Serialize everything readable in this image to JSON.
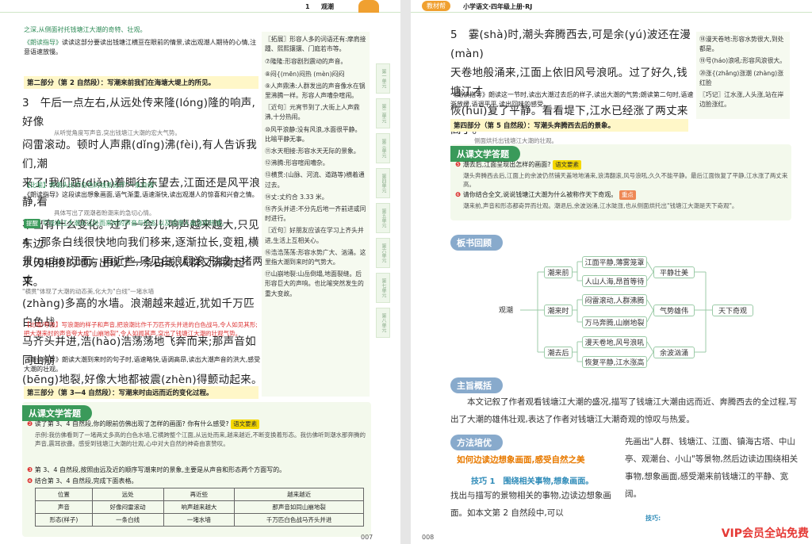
{
  "left": {
    "header": {
      "lesson_num": "1",
      "lesson_title": "观潮"
    },
    "top_text_1": "之深,从侧面衬托钱塘江大潮的奇特、壮观。",
    "top_guide_label": "《朗读指导》",
    "top_guide_text": "读读这部分要读出钱塘江横亘在眼前的情景,读出观潮人期待的心情,注意语速放慢。",
    "part2": "第二部分（第 2 自然段）：写潮来前我们在海塘大堤上的所见。",
    "para3_lines": [
      "3　午后一点左右,从远处传来隆(lóng)隆的响声,好像",
      "闷雷滚动。顿时人声鼎(dǐng)沸(fèi),有人告诉我们,潮",
      "来了!我们踮(diǎn)着脚往东望去,江面还是风平浪静,看",
      "不出有什么变化。过了一会儿,响声越来越大,只见东边",
      "水天相接的地方出现了一条白线,人群又沸腾起来。"
    ],
    "para3_note1": "从听觉角度写声音,突出钱塘江大潮的宏大气势。",
    "para3_note2": "具体写出了观潮者盼潮来的急切心情。",
    "para3_note3": "【比喻】将潮头比作白色的线条比作\"一条白线\"",
    "para3_guide": "《朗读指导》这段读出想象画面,语气渐重,语速渐快,读出观潮人的惊喜和兴奋之情。",
    "tidian": "提醒",
    "tidian_text": "写钱塘江大潮从远处而来时的声音与形态,以及观潮人高涨的热情。",
    "para4_lines": [
      "4　那条白线很快地向我们移来,逐渐拉长,变粗,横",
      "贯(guàn)江面。再近些,只见白浪翻滚,形成一堵两丈",
      "(zhàng)多高的水墙。浪潮越来越近,犹如千万匹白色战",
      "马齐头并进,浩(hào)浩荡荡地飞奔而来;那声音如同山崩",
      "(bēng)地裂,好像大地都被震(zhèn)得颤动起来。"
    ],
    "para4_note1": "\"横贯\"体现了大潮的动态美,化大为\"白线\"一堵水墙",
    "para4_note2": "【比喻/夸张】写浪潮的样子和声音,把浪潮比作千万匹齐头并进的白色战马,令人如见其形;把大潮来时的声音夸大成\"山崩地裂\",令人如闻其声,突出了钱塘江大潮的壮观气势。",
    "para4_guide": "《朗读指导》朗读大潮到来时的句子时,语速略快,语调高昂,读出大潮声音的洪大,感受大潮的壮观。",
    "part3": "第三部分（第 3—4 自然段）：写潮来时由远而近的变化过程。",
    "qa_title": "从课文学答题",
    "q2": "读了第 3、4 自然段,你的眼前仿佛出现了怎样的画面? 你有什么感受?",
    "q2_tag": "语文要素",
    "q2_ans": "示例:我仿佛看到了一堵两丈多高的白色水墙,它横跨整个江面,从远处而来,越来越近,不断变换着形态。我仿佛听到潮水那奔腾的声音,震耳欲聋。感受到钱塘江大潮的壮观,心中对大自然的神奇由衷赞叹。",
    "q3": "第 3、4 自然段,按照由远及近的顺序写潮来时的景象,主要是从声音和形态两个方面写的。",
    "q4": "结合第 3、4 自然段,完成下面表格。",
    "table_head": [
      "位置",
      "远处",
      "再近些",
      "越来越近"
    ],
    "table_rows": [
      [
        "声音",
        "好像闷雷滚动",
        "响声越来越大",
        "那声音如同山崩地裂"
      ],
      [
        "形态(样子)",
        "一条白线",
        "一堵水墙",
        "千万匹白色战马齐头并进"
      ]
    ],
    "side_intro": "〖拓展〗形容人多的词语还有:摩肩接踵、熙熙攘攘、门庭若市等。",
    "side_items": [
      "⑦隆隆:形容剧烈震动的声音。",
      "⑧闷{(mēn)闷热 (mèn)闷闷",
      "⑨人声鼎沸:人群发出的声音像水在锅里沸腾一样。形容人声嘈杂喧闹。",
      "〖近句〗元宵节到了,大街上人声鼎沸,十分热闹。",
      "⑩风平浪静:没有风浪,水面很平静。比喻平静无事。",
      "⑪水天相接:形容水天无际的景象。",
      "⑫沸腾:形容喧闹嘈杂。",
      "⑬横贯:(山脉、河流、道路等)横着通过去。",
      "⑭丈:丈约合 3.33 米。",
      "⑮齐头并进:不分先后地一齐前进或同时进行。",
      "〖近句〗好朋友应该在学习上齐头并进,生活上互相关心。",
      "⑯浩浩荡荡:形容水势广大、汹涌。这里指大潮到来时的气势大。",
      "⑰山崩地裂:山岳倒塌,地面裂缝。后形容巨大的声响。也比喻突然发生的重大变故。"
    ],
    "page_num": "007"
  },
  "right": {
    "header": {
      "brand": "教材帮",
      "subject": "小学语文·四年级上册·RJ"
    },
    "para5_lines": [
      "5　霎(shà)时,潮头奔腾西去,可是余(yú)波还在漫(màn)",
      "天卷地般涌来,江面上依旧风号浪吼。过了好久,钱塘江才",
      "恢(huī)复了平静。看看堤下,江水已经涨了两丈来高了。"
    ],
    "para5_note": "描写潮头奔腾西去时的景象。",
    "para5_note2": "侧面烘托出钱塘江大潮的壮观。",
    "para5_guide": "《朗读指导》朗读这一节时,读出大潮过去后的样子,读出大潮的气势;朗读第二句时,语速渐放缓,语调平平,读出回味的感受。",
    "part4": "第四部分（第 5 自然段）：写潮头奔腾西去后的景象。",
    "qa_title": "从课文学答题",
    "q5": "潮去后,江面呈现出怎样的画面?",
    "q5_tag": "语文要素",
    "q5_ans": "潮头奔腾西去后,江面上的余波仍然铺天盖地地涌来,浪涛翻滚,风号浪吼,久久不能平静。最后江面恢复了平静,江水涨了两丈来高。",
    "q6": "请你结合全文,说说钱塘江大潮为什么被称作天下奇观。",
    "q6_tag": "重点",
    "q6_ans": "潮来前,声音和形态都奇异而壮观。潮退后,余波汹涌,江水陡涨,也从侧面烘托出\"钱塘江大潮是天下奇观\"。",
    "board_title": "板书回顾",
    "board": {
      "root": "观潮",
      "before": "潮来前",
      "during": "潮来时",
      "after": "潮去后",
      "b1": "江面平静,薄雾笼罩",
      "b2": "人山人海,昂首等待",
      "d1": "闷雷滚动,人群沸腾",
      "d2": "万马奔腾,山崩地裂",
      "a1": "漫天卷地,风号浪吼",
      "a2": "恢复平静,江水涨高",
      "r1": "平静壮美",
      "r2": "气势雄伟",
      "r3": "余波汹涌",
      "final": "天下奇观"
    },
    "summary_title": "主旨概括",
    "summary_text": "本文记叙了作者观看钱塘江大潮的盛况,描写了钱塘江大潮由远而近、奔腾西去的全过程,写出了大潮的雄伟壮观,表达了作者对钱塘江大潮奇观的惊叹与热爱。",
    "method_title": "方法培优",
    "method_sub": "如何边读边想象画面,感受自然之美",
    "tip1": "技巧 1　围绕相关事物,想象画面。",
    "tip1_text": "找出与描写的景物相关的事物,边读边想象画面。如本文第 2 自然段中,可以",
    "right_col": "先画出\"人群、钱塘江、江面、镇海古塔、中山亭、观潮台、小山\"等景物,然后边读边围绕相关事物,想象画面,感受潮来前钱塘江的平静、宽阔。",
    "tip2_label": "技巧:",
    "side_items": [
      "⑱漫天卷地:形容水势很大,到处都是。",
      "⑲号(háo)浪吼:形容风浪很大。",
      "⑳涨{(zhǎng)涨潮 (zhàng)涨红脸",
      "〖巧记〗江水涨,人头涨,站在岸边脸涨红。"
    ],
    "page_num": "008",
    "vip": "VIP会员全站免费"
  }
}
